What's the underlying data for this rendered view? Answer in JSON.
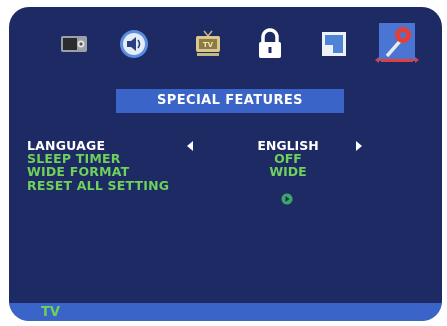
{
  "menu": {
    "icons": [
      "picture-icon",
      "sound-icon",
      "tv-icon",
      "lock-icon",
      "screen-icon",
      "tools-icon"
    ],
    "selected_icon": "tools-icon",
    "title": "SPECIAL FEATURES",
    "items": [
      {
        "label": "LANGUAGE",
        "value": "ENGLISH"
      },
      {
        "label": "SLEEP TIMER",
        "value": "OFF"
      },
      {
        "label": "WIDE FORMAT",
        "value": "WIDE"
      },
      {
        "label": "RESET ALL SETTING",
        "value": ""
      }
    ]
  },
  "footer": {
    "source": "TV"
  },
  "colors": {
    "background": "#1e2a64",
    "highlight": "#3a64c8",
    "label": "#6ed25a",
    "active": "#ffffff",
    "selected_marker": "#e0403a"
  }
}
